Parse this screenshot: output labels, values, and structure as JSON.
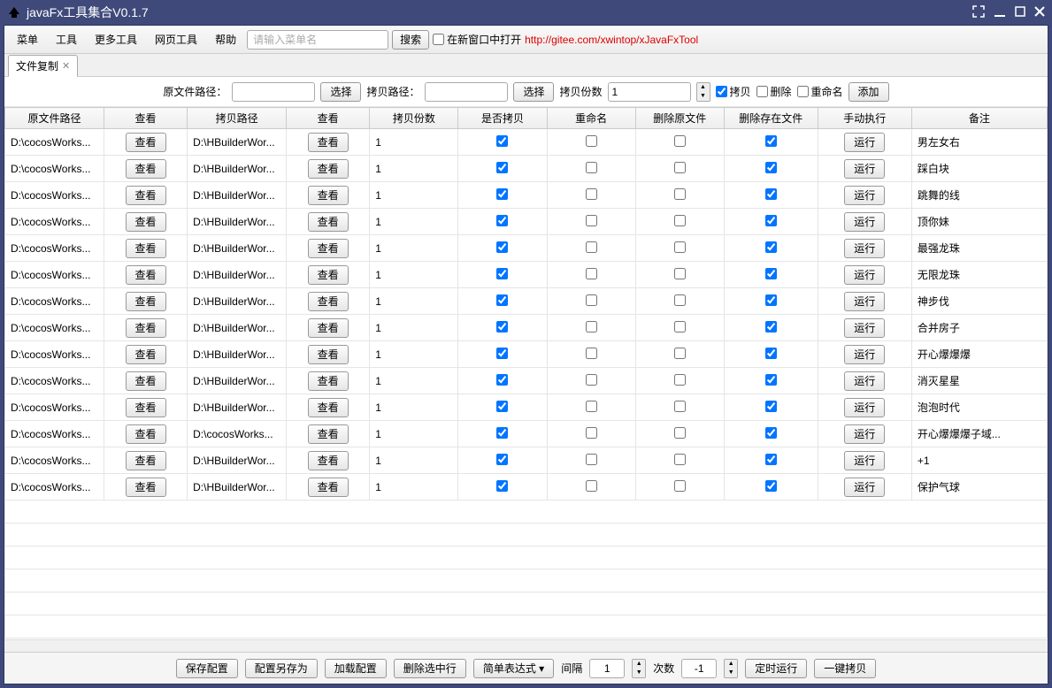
{
  "window": {
    "title": "javaFx工具集合V0.1.7"
  },
  "menu": {
    "items": [
      "菜单",
      "工具",
      "更多工具",
      "网页工具",
      "帮助"
    ],
    "search_placeholder": "请输入菜单名",
    "search_btn": "搜索",
    "open_new_label": "在新窗口中打开",
    "link_text": "http://gitee.com/xwintop/xJavaFxTool"
  },
  "tab": {
    "label": "文件复制"
  },
  "toolbar": {
    "src_label": "原文件路径：",
    "select": "选择",
    "dst_label": "拷贝路径：",
    "count_label": "拷贝份数",
    "count_value": "1",
    "copy_label": "拷贝",
    "del_label": "删除",
    "rename_label": "重命名",
    "add_btn": "添加"
  },
  "cols": [
    "原文件路径",
    "查看",
    "拷贝路径",
    "查看",
    "拷贝份数",
    "是否拷贝",
    "重命名",
    "删除原文件",
    "删除存在文件",
    "手动执行",
    "备注"
  ],
  "view_btn": "查看",
  "run_btn": "运行",
  "rows": [
    {
      "src": "D:\\cocosWorks...",
      "dst": "D:\\HBuilderWor...",
      "cnt": "1",
      "copy": true,
      "ren": false,
      "delS": false,
      "delE": true,
      "note": "男左女右"
    },
    {
      "src": "D:\\cocosWorks...",
      "dst": "D:\\HBuilderWor...",
      "cnt": "1",
      "copy": true,
      "ren": false,
      "delS": false,
      "delE": true,
      "note": "踩白块"
    },
    {
      "src": "D:\\cocosWorks...",
      "dst": "D:\\HBuilderWor...",
      "cnt": "1",
      "copy": true,
      "ren": false,
      "delS": false,
      "delE": true,
      "note": "跳舞的线"
    },
    {
      "src": "D:\\cocosWorks...",
      "dst": "D:\\HBuilderWor...",
      "cnt": "1",
      "copy": true,
      "ren": false,
      "delS": false,
      "delE": true,
      "note": "顶你妹"
    },
    {
      "src": "D:\\cocosWorks...",
      "dst": "D:\\HBuilderWor...",
      "cnt": "1",
      "copy": true,
      "ren": false,
      "delS": false,
      "delE": true,
      "note": "最强龙珠"
    },
    {
      "src": "D:\\cocosWorks...",
      "dst": "D:\\HBuilderWor...",
      "cnt": "1",
      "copy": true,
      "ren": false,
      "delS": false,
      "delE": true,
      "note": "无限龙珠"
    },
    {
      "src": "D:\\cocosWorks...",
      "dst": "D:\\HBuilderWor...",
      "cnt": "1",
      "copy": true,
      "ren": false,
      "delS": false,
      "delE": true,
      "note": "神步伐"
    },
    {
      "src": "D:\\cocosWorks...",
      "dst": "D:\\HBuilderWor...",
      "cnt": "1",
      "copy": true,
      "ren": false,
      "delS": false,
      "delE": true,
      "note": "合并房子"
    },
    {
      "src": "D:\\cocosWorks...",
      "dst": "D:\\HBuilderWor...",
      "cnt": "1",
      "copy": true,
      "ren": false,
      "delS": false,
      "delE": true,
      "note": "开心爆爆爆"
    },
    {
      "src": "D:\\cocosWorks...",
      "dst": "D:\\HBuilderWor...",
      "cnt": "1",
      "copy": true,
      "ren": false,
      "delS": false,
      "delE": true,
      "note": "消灭星星"
    },
    {
      "src": "D:\\cocosWorks...",
      "dst": "D:\\HBuilderWor...",
      "cnt": "1",
      "copy": true,
      "ren": false,
      "delS": false,
      "delE": true,
      "note": "泡泡时代"
    },
    {
      "src": "D:\\cocosWorks...",
      "dst": "D:\\cocosWorks...",
      "cnt": "1",
      "copy": true,
      "ren": false,
      "delS": false,
      "delE": true,
      "note": "开心爆爆爆子域..."
    },
    {
      "src": "D:\\cocosWorks...",
      "dst": "D:\\HBuilderWor...",
      "cnt": "1",
      "copy": true,
      "ren": false,
      "delS": false,
      "delE": true,
      "note": "+1"
    },
    {
      "src": "D:\\cocosWorks...",
      "dst": "D:\\HBuilderWor...",
      "cnt": "1",
      "copy": true,
      "ren": false,
      "delS": false,
      "delE": true,
      "note": "保护气球"
    }
  ],
  "footer": {
    "save_cfg": "保存配置",
    "save_as": "配置另存为",
    "load_cfg": "加载配置",
    "del_row": "删除选中行",
    "expr": "简单表达式",
    "interval_label": "间隔",
    "interval_value": "1",
    "times_label": "次数",
    "times_value": "-1",
    "timer_run": "定时运行",
    "copy_all": "一键拷贝"
  }
}
